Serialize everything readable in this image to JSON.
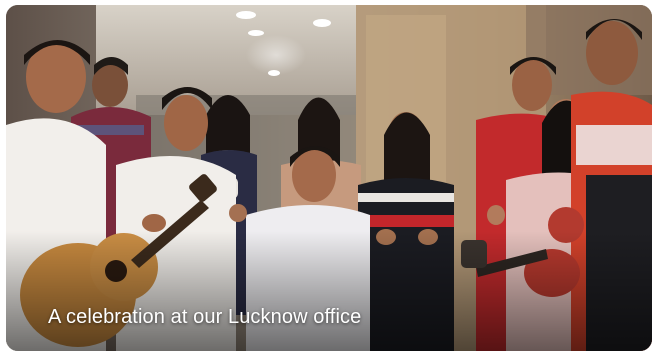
{
  "card": {
    "caption": "A celebration at our Lucknow office"
  }
}
